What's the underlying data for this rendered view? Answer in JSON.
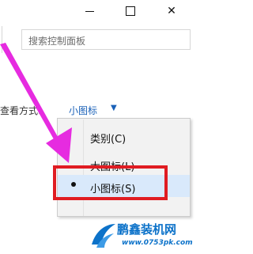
{
  "window": {
    "minimize_symbol": "",
    "close_symbol": "✕"
  },
  "search": {
    "placeholder": "搜索控制面板"
  },
  "view": {
    "label": "查看方式:",
    "selected": "小图标",
    "caret": "▼"
  },
  "menu": {
    "items": [
      {
        "label": "类别(C)",
        "selected": false
      },
      {
        "label": "大图标(L)",
        "selected": false
      },
      {
        "label": "小图标(S)",
        "selected": true
      }
    ]
  },
  "colors": {
    "highlight": "#e01c22",
    "arrow": "#e62be0",
    "link": "#1a61b8",
    "selected_bg": "#d9e9fb",
    "watermark": "#0c72c9"
  },
  "watermark": {
    "title": "鹏鑫装机网",
    "url": "www.0753pk.com"
  }
}
